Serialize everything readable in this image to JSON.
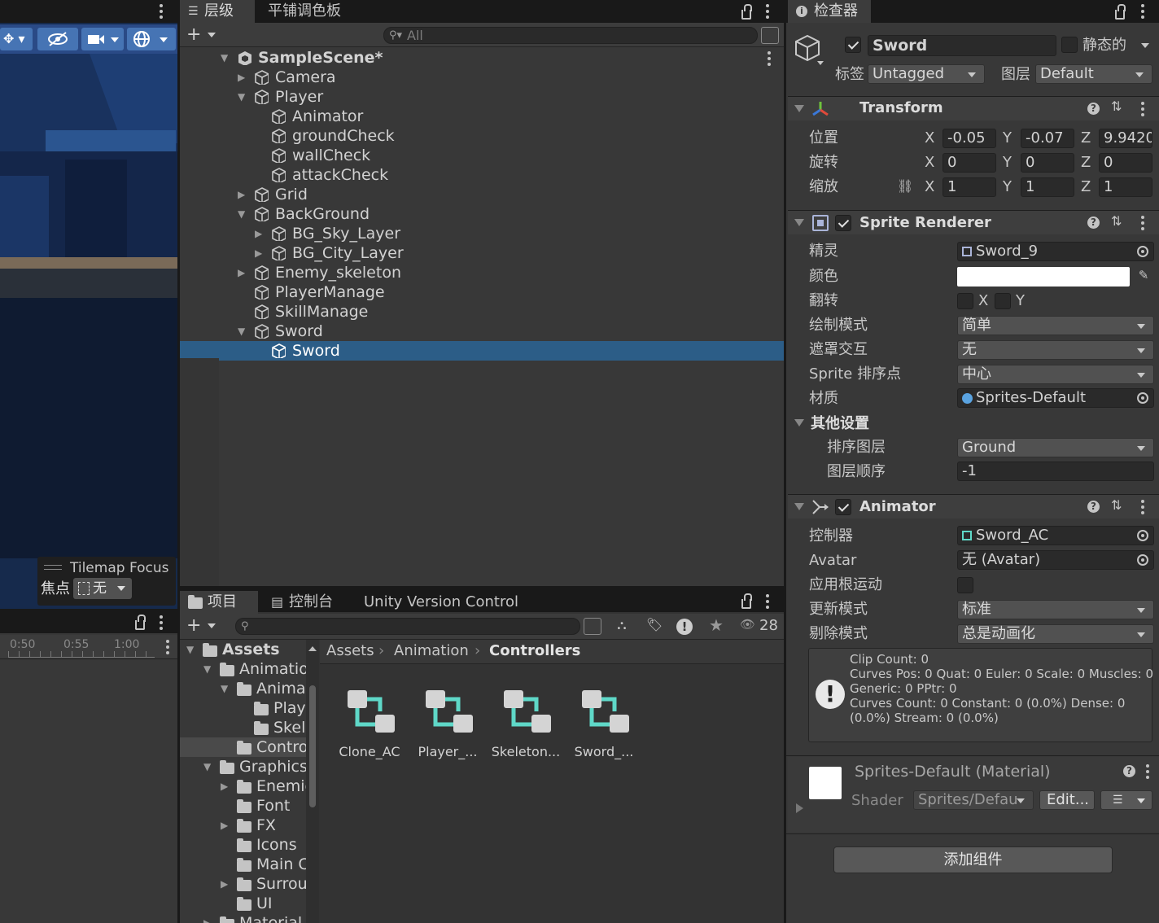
{
  "scene": {
    "tilemap_focus_title": "Tilemap Focus",
    "focus_label": "焦点",
    "focus_value": "无",
    "timeline_ticks": [
      "0:50",
      "0:55",
      "1:00"
    ]
  },
  "hierarchy": {
    "tabs": [
      "层级",
      "平铺调色板"
    ],
    "add_label": "+",
    "search_placeholder": "All",
    "rows": [
      {
        "label": "SampleScene*",
        "depth": 0,
        "expand": "open",
        "bold": true,
        "icon": "unity-scene-icon"
      },
      {
        "label": "Camera",
        "depth": 1,
        "expand": "closed"
      },
      {
        "label": "Player",
        "depth": 1,
        "expand": "open"
      },
      {
        "label": "Animator",
        "depth": 2,
        "expand": "none"
      },
      {
        "label": "groundCheck",
        "depth": 2,
        "expand": "none"
      },
      {
        "label": "wallCheck",
        "depth": 2,
        "expand": "none"
      },
      {
        "label": "attackCheck",
        "depth": 2,
        "expand": "none"
      },
      {
        "label": "Grid",
        "depth": 1,
        "expand": "closed"
      },
      {
        "label": "BackGround",
        "depth": 1,
        "expand": "open"
      },
      {
        "label": "BG_Sky_Layer",
        "depth": 2,
        "expand": "closed"
      },
      {
        "label": "BG_City_Layer",
        "depth": 2,
        "expand": "closed"
      },
      {
        "label": "Enemy_skeleton",
        "depth": 1,
        "expand": "closed"
      },
      {
        "label": "PlayerManage",
        "depth": 1,
        "expand": "none"
      },
      {
        "label": "SkillManage",
        "depth": 1,
        "expand": "none"
      },
      {
        "label": "Sword",
        "depth": 1,
        "expand": "open"
      },
      {
        "label": "Sword",
        "depth": 2,
        "expand": "none",
        "selected": true
      }
    ]
  },
  "project": {
    "tabs": [
      "项目",
      "控制台",
      "Unity Version Control"
    ],
    "add_label": "+",
    "hidden_count": "28",
    "breadcrumb": [
      "Assets",
      "Animation",
      "Controllers"
    ],
    "tree": [
      {
        "label": "Assets",
        "depth": 0,
        "expand": "open",
        "bold": true
      },
      {
        "label": "Animatio",
        "depth": 1,
        "expand": "open"
      },
      {
        "label": "Animat",
        "depth": 2,
        "expand": "open"
      },
      {
        "label": "Play",
        "depth": 3,
        "expand": "none"
      },
      {
        "label": "Skel",
        "depth": 3,
        "expand": "none"
      },
      {
        "label": "Contro",
        "depth": 2,
        "expand": "none",
        "selected": true
      },
      {
        "label": "Graphics",
        "depth": 1,
        "expand": "open"
      },
      {
        "label": "Enemie",
        "depth": 2,
        "expand": "closed"
      },
      {
        "label": "Font",
        "depth": 2,
        "expand": "none"
      },
      {
        "label": "FX",
        "depth": 2,
        "expand": "closed"
      },
      {
        "label": "Icons",
        "depth": 2,
        "expand": "none"
      },
      {
        "label": "Main C",
        "depth": 2,
        "expand": "none"
      },
      {
        "label": "Surrou",
        "depth": 2,
        "expand": "closed"
      },
      {
        "label": "UI",
        "depth": 2,
        "expand": "none"
      },
      {
        "label": "Material",
        "depth": 1,
        "expand": "closed"
      }
    ],
    "assets": [
      "Clone_AC",
      "Player_...",
      "Skeleton...",
      "Sword_..."
    ],
    "asset_icon_color": "#5fd8c8"
  },
  "inspector": {
    "tab_label": "检查器",
    "object_name": "Sword",
    "object_active": true,
    "static_label": "静态的",
    "tag_label": "标签",
    "tag_value": "Untagged",
    "layer_label": "图层",
    "layer_value": "Default",
    "transform": {
      "title": "Transform",
      "rows": [
        {
          "label": "位置",
          "x": "-0.05",
          "y": "-0.07",
          "z": "9.9420"
        },
        {
          "label": "旋转",
          "x": "0",
          "y": "0",
          "z": "0"
        },
        {
          "label": "缩放",
          "x": "1",
          "y": "1",
          "z": "1"
        }
      ],
      "axis_x": "X",
      "axis_y": "Y",
      "axis_z": "Z"
    },
    "sprite_renderer": {
      "title": "Sprite Renderer",
      "sprite_label": "精灵",
      "sprite_value": "Sword_9",
      "color_label": "颜色",
      "color_value": "#ffffff",
      "flip_label": "翻转",
      "flip_x": "X",
      "flip_y": "Y",
      "draw_mode_label": "绘制模式",
      "draw_mode_value": "简单",
      "mask_label": "遮罩交互",
      "mask_value": "无",
      "sort_point_label": "Sprite 排序点",
      "sort_point_value": "中心",
      "material_label": "材质",
      "material_value": "Sprites-Default",
      "additional_label": "其他设置",
      "sorting_layer_label": "排序图层",
      "sorting_layer_value": "Ground",
      "order_label": "图层顺序",
      "order_value": "-1"
    },
    "animator": {
      "title": "Animator",
      "controller_label": "控制器",
      "controller_value": "Sword_AC",
      "avatar_label": "Avatar",
      "avatar_value": "无 (Avatar)",
      "root_motion_label": "应用根运动",
      "update_label": "更新模式",
      "update_value": "标准",
      "culling_label": "剔除模式",
      "culling_value": "总是动画化",
      "info_lines": [
        "Clip Count: 0",
        "Curves Pos: 0 Quat: 0 Euler: 0 Scale: 0 Muscles: 0",
        "Generic: 0 PPtr: 0",
        "Curves Count: 0 Constant: 0 (0.0%) Dense: 0",
        "(0.0%) Stream: 0 (0.0%)"
      ]
    },
    "material_preview": {
      "title": "Sprites-Default (Material)",
      "shader_label": "Shader",
      "shader_value": "Sprites/Defau",
      "edit_label": "Edit..."
    },
    "add_component_label": "添加组件"
  },
  "colors": {
    "panel_bg": "#383838",
    "selection": "#2c5d87",
    "accent_blue": "#3a79bb"
  }
}
